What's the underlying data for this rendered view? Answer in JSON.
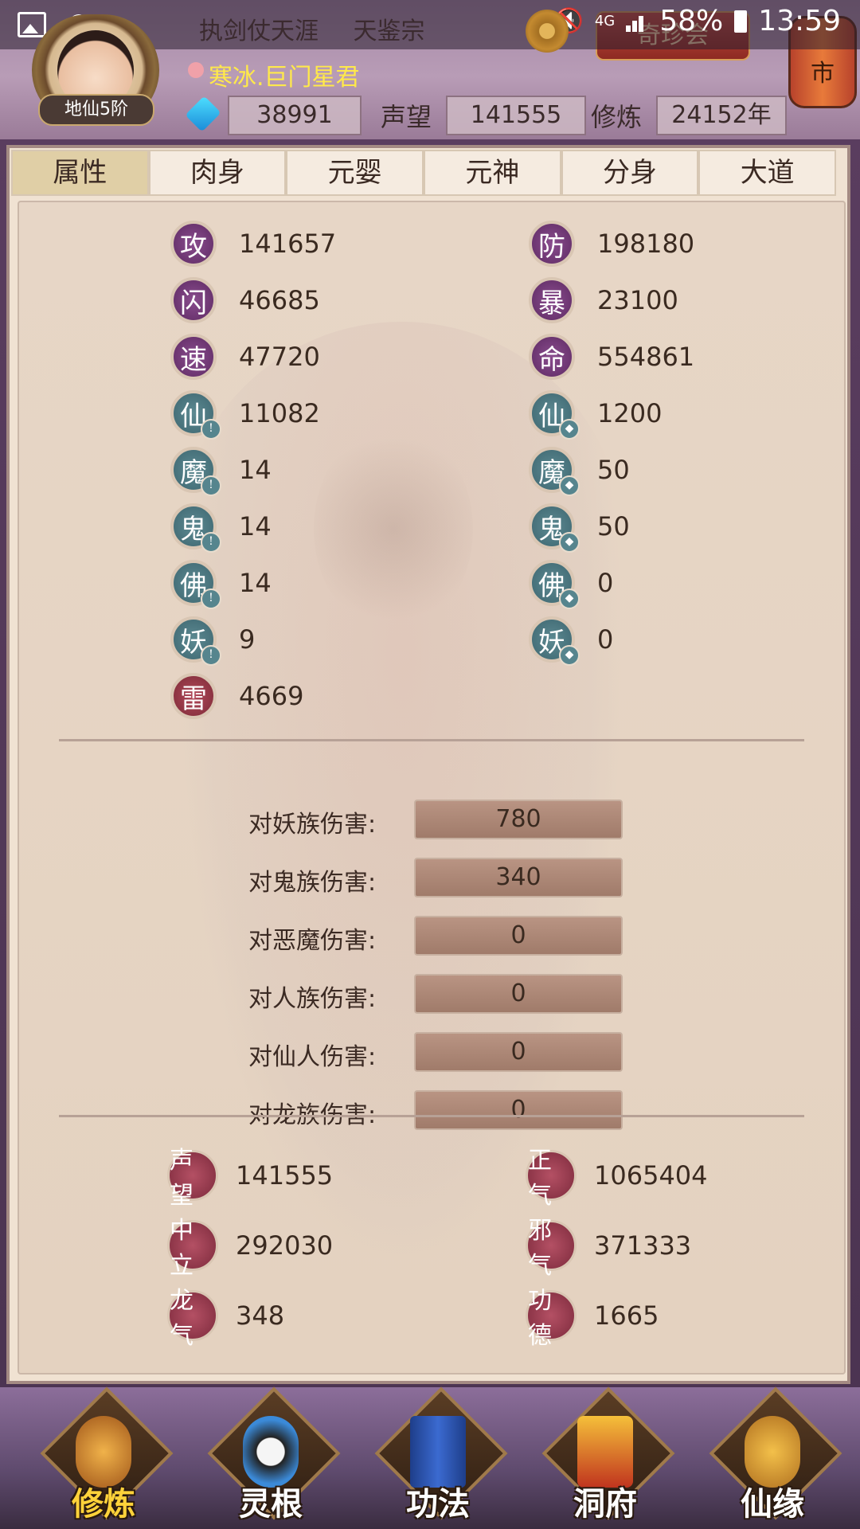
{
  "status_bar": {
    "network": "4G",
    "battery": "58%",
    "time": "13:59"
  },
  "header": {
    "rank": "地仙5阶",
    "tabs": [
      "执剑仗天涯",
      "天鉴宗"
    ],
    "shop_label": "奇珍会",
    "lantern_text": "市",
    "player_name": "寒冰.巨门星君",
    "gems": "38991",
    "prestige_label": "声望",
    "prestige_value": "141555",
    "cultivation_label": "修炼",
    "cultivation_value": "24152年"
  },
  "tabs": [
    {
      "label": "属性",
      "active": true
    },
    {
      "label": "肉身",
      "active": false
    },
    {
      "label": "元婴",
      "active": false
    },
    {
      "label": "元神",
      "active": false
    },
    {
      "label": "分身",
      "active": false
    },
    {
      "label": "大道",
      "active": false
    }
  ],
  "attributes_left": [
    {
      "icon": "攻",
      "value": "141657",
      "color": "#6e3a72"
    },
    {
      "icon": "闪",
      "value": "46685",
      "color": "#6e3a72"
    },
    {
      "icon": "速",
      "value": "47720",
      "color": "#6e3a72"
    },
    {
      "icon": "仙",
      "value": "11082",
      "color": "#4d7a82",
      "badge": "!"
    },
    {
      "icon": "魔",
      "value": "14",
      "color": "#4d7a82",
      "badge": "!"
    },
    {
      "icon": "鬼",
      "value": "14",
      "color": "#4d7a82",
      "badge": "!"
    },
    {
      "icon": "佛",
      "value": "14",
      "color": "#4d7a82",
      "badge": "!"
    },
    {
      "icon": "妖",
      "value": "9",
      "color": "#4d7a82",
      "badge": "!"
    },
    {
      "icon": "雷",
      "value": "4669",
      "color": "#a33a4c"
    }
  ],
  "attributes_right": [
    {
      "icon": "防",
      "value": "198180",
      "color": "#6e3a72"
    },
    {
      "icon": "暴",
      "value": "23100",
      "color": "#6e3a72"
    },
    {
      "icon": "命",
      "value": "554861",
      "color": "#6e3a72"
    },
    {
      "icon": "仙",
      "value": "1200",
      "color": "#4d7a82",
      "badge": "shield"
    },
    {
      "icon": "魔",
      "value": "50",
      "color": "#4d7a82",
      "badge": "shield"
    },
    {
      "icon": "鬼",
      "value": "50",
      "color": "#4d7a82",
      "badge": "shield"
    },
    {
      "icon": "佛",
      "value": "0",
      "color": "#4d7a82",
      "badge": "shield"
    },
    {
      "icon": "妖",
      "value": "0",
      "color": "#4d7a82",
      "badge": "shield"
    }
  ],
  "damage": [
    {
      "label": "对妖族伤害:",
      "value": "780"
    },
    {
      "label": "对鬼族伤害:",
      "value": "340"
    },
    {
      "label": "对恶魔伤害:",
      "value": "0"
    },
    {
      "label": "对人族伤害:",
      "value": "0"
    },
    {
      "label": "对仙人伤害:",
      "value": "0"
    },
    {
      "label": "对龙族伤害:",
      "value": "0"
    }
  ],
  "reputation": [
    {
      "icon": "声望",
      "value": "141555"
    },
    {
      "icon": "正气",
      "value": "1065404"
    },
    {
      "icon": "中立",
      "value": "292030"
    },
    {
      "icon": "邪气",
      "value": "371333"
    },
    {
      "icon": "龙气",
      "value": "348"
    },
    {
      "icon": "功德",
      "value": "1665"
    }
  ],
  "bottom_nav": [
    {
      "label": "修炼",
      "active": true
    },
    {
      "label": "灵根",
      "active": false
    },
    {
      "label": "功法",
      "active": false
    },
    {
      "label": "洞府",
      "active": false
    },
    {
      "label": "仙缘",
      "active": false
    }
  ]
}
